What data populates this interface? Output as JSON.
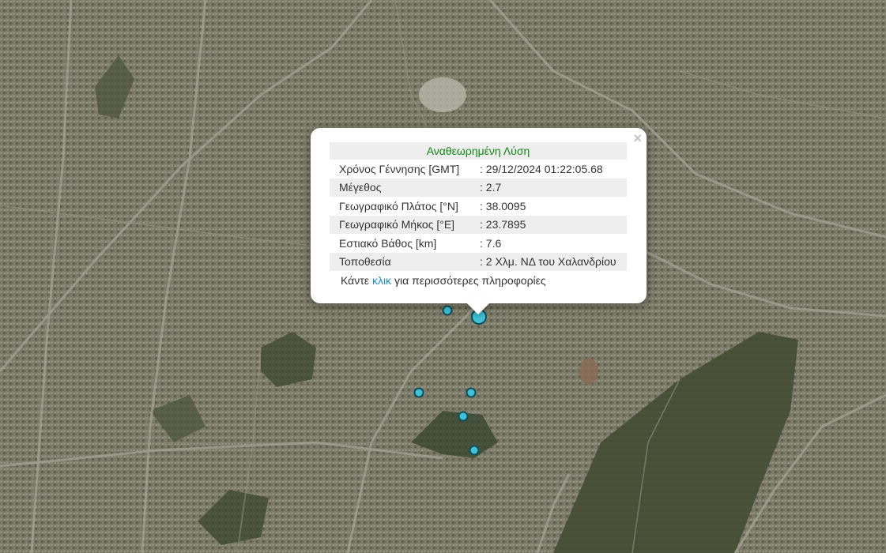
{
  "map": {
    "marker_color": "#3fc2d6",
    "marker_count": 6
  },
  "popup": {
    "title": "Αναθεωρημένη Λύση",
    "close_symbol": "×",
    "rows": [
      {
        "label": "Χρόνος Γέννησης [GMT]",
        "value": ": 29/12/2024 01:22:05.68"
      },
      {
        "label": "Μέγεθος",
        "value": ": 2.7"
      },
      {
        "label": "Γεωγραφικό Πλάτος [°N]",
        "value": ": 38.0095"
      },
      {
        "label": "Γεωγραφικό Μήκος [°E]",
        "value": ": 23.7895"
      },
      {
        "label": "Εστιακό Βάθος [km]",
        "value": ": 7.6"
      },
      {
        "label": "Τοποθεσία",
        "value": ": 2 Χλμ. ΝΔ του Χαλανδρίου"
      }
    ],
    "more_prefix": "Κάντε",
    "more_link": "κλικ",
    "more_suffix": "για περισσότερες πληροφορίες",
    "title_color": "#138613",
    "link_color": "#1e8cc8"
  }
}
